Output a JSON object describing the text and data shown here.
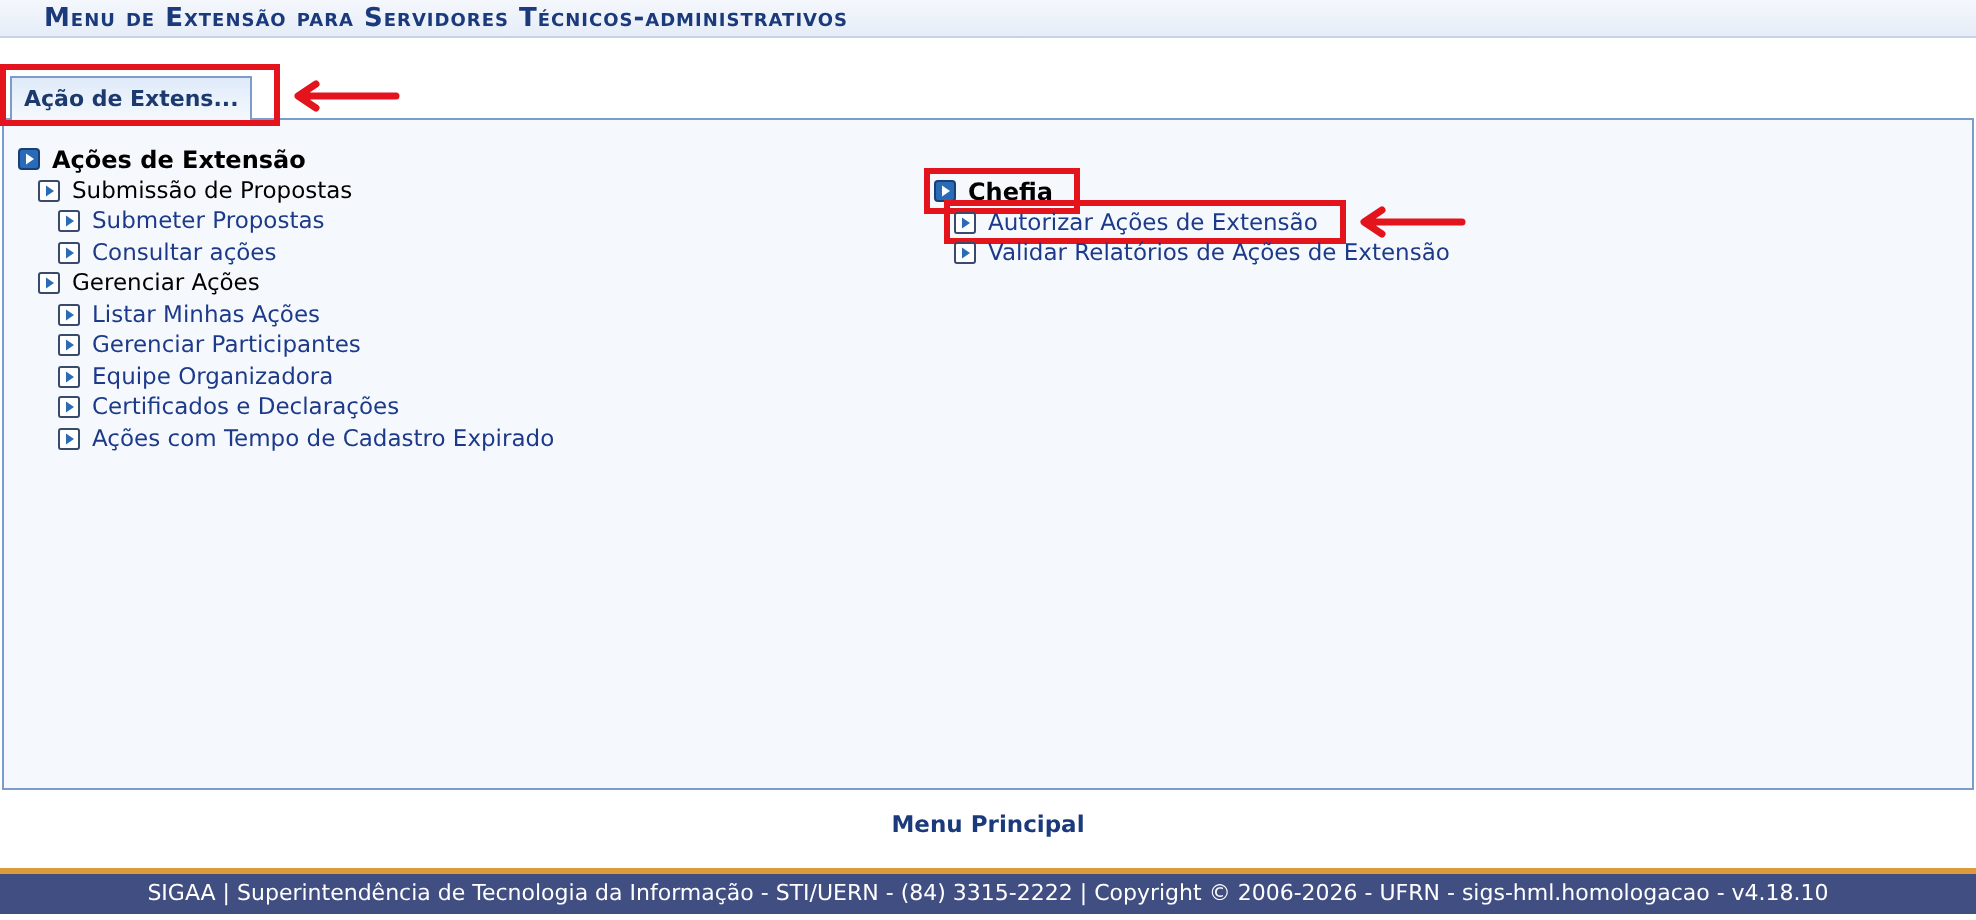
{
  "header": {
    "title": "Menu de Extensão para Servidores Técnicos-administrativos"
  },
  "tabs": [
    {
      "label": "Ação de Extens...",
      "selected": true,
      "boxed": true,
      "arrow": true
    }
  ],
  "menu_columns": [
    {
      "items": [
        {
          "label": "Ações de Extensão",
          "kind": "section",
          "children": [
            {
              "label": "Submissão de Propostas",
              "kind": "group",
              "children": [
                {
                  "label": "Submeter Propostas",
                  "kind": "link"
                },
                {
                  "label": "Consultar ações",
                  "kind": "link"
                }
              ]
            },
            {
              "label": "Gerenciar Ações",
              "kind": "group",
              "children": [
                {
                  "label": "Listar Minhas Ações",
                  "kind": "link"
                },
                {
                  "label": "Gerenciar Participantes",
                  "kind": "link"
                },
                {
                  "label": "Equipe Organizadora",
                  "kind": "link"
                },
                {
                  "label": "Certificados e Declarações",
                  "kind": "link"
                },
                {
                  "label": "Ações com Tempo de Cadastro Expirado",
                  "kind": "link"
                }
              ]
            }
          ]
        }
      ]
    },
    {
      "items": [
        {
          "label": "Chefia",
          "kind": "section",
          "boxed": true,
          "children": [
            {
              "label": "Autorizar Ações de Extensão",
              "kind": "link",
              "boxed": true,
              "arrow": true
            },
            {
              "label": "Validar Relatórios de Ações de Extensão",
              "kind": "link"
            }
          ]
        }
      ]
    }
  ],
  "footer_link": "Menu Principal",
  "status_bar": "SIGAA | Superintendência de Tecnologia da Informação - STI/UERN - (84) 3315-2222 | Copyright © 2006-2026 - UFRN - sigs-hml.homologacao - v4.18.10"
}
